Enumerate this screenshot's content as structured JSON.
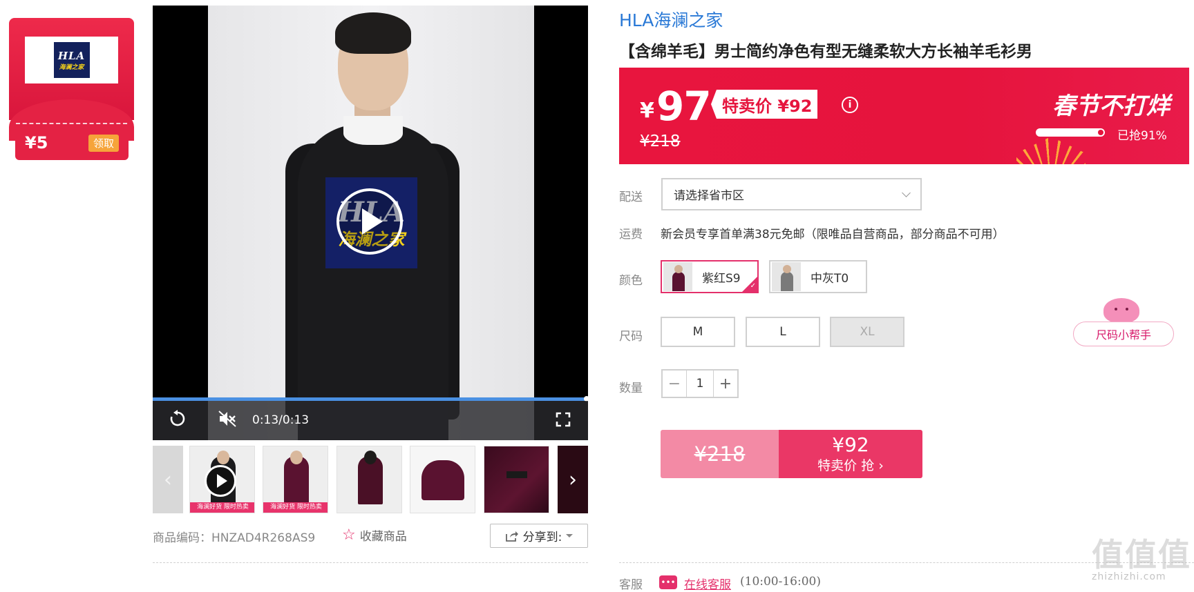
{
  "coupon": {
    "logo_top": "HLA",
    "logo_bottom": "海澜之家",
    "amount": "¥5",
    "claim_label": "领取"
  },
  "video": {
    "logo_top": "HLA",
    "logo_bottom": "海澜之家",
    "time": "0:13/0:13",
    "progress": 1.0
  },
  "thumbnails": {
    "badge": "海澜好货 限时热卖"
  },
  "product": {
    "code_label": "商品编码：HNZAD4R268AS9",
    "favorite_label": "收藏商品",
    "share_label": "分享到:",
    "brand": "HLA海澜之家",
    "title": "【含绵羊毛】男士简约净色有型无缝柔软大方长袖羊毛衫男"
  },
  "price": {
    "yen": "¥",
    "current": "97",
    "special_tag": "特卖价 ¥92",
    "original": "¥218",
    "slogan": "春节不打烊",
    "sold_label": "已抢91%",
    "sold_fraction": 0.91
  },
  "delivery": {
    "label": "配送",
    "placeholder": "请选择省市区"
  },
  "shipping": {
    "label": "运费",
    "text": "新会员专享首单满38元免邮（限唯品自营商品，部分商品不可用）"
  },
  "colors": {
    "label": "颜色",
    "options": [
      {
        "name": "紫红S9",
        "selected": true,
        "swatch": "#5a1230"
      },
      {
        "name": "中灰T0",
        "selected": false,
        "swatch": "#7a7a7a"
      }
    ]
  },
  "sizes": {
    "label": "尺码",
    "options": [
      "M",
      "L",
      "XL"
    ],
    "disabled": [
      "XL"
    ],
    "helper": "尺码小帮手"
  },
  "quantity": {
    "label": "数量",
    "minus": "−",
    "value": "1",
    "plus": "+"
  },
  "buy": {
    "original": "¥218",
    "price": "¥92",
    "action": "特卖价 抢 ›"
  },
  "service": {
    "label": "客服",
    "icon": "•••",
    "link": "在线客服",
    "hours": "(10:00-16:00)"
  },
  "watermark": {
    "main": "值值值",
    "sub": "zhizhizhi.com"
  },
  "theme": {
    "accent": "#e4306b",
    "banner": "#e6143d",
    "brand": "#2a79d6"
  }
}
